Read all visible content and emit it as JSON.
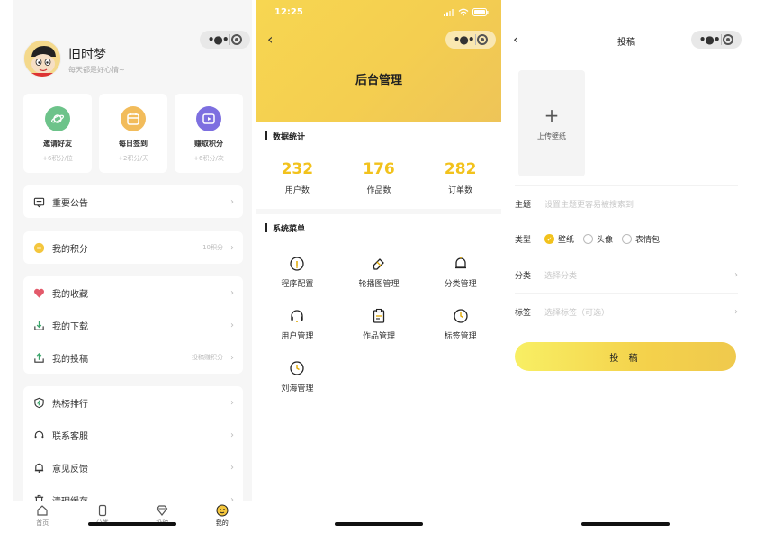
{
  "profile": {
    "name": "旧时梦",
    "sign": "每天都是好心情~",
    "cards": [
      {
        "title": "邀请好友",
        "sub": "+6积分/位",
        "color": "#6dc38a",
        "icon": "planet-icon"
      },
      {
        "title": "每日签到",
        "sub": "+2积分/天",
        "color": "#f2bc5b",
        "icon": "calendar-icon"
      },
      {
        "title": "赚取积分",
        "sub": "+6积分/次",
        "color": "#7d6fe0",
        "icon": "video-icon"
      }
    ],
    "notice": "重要公告",
    "points_label": "我的积分",
    "points_value": "10积分",
    "favorites": "我的收藏",
    "downloads": "我的下载",
    "posts": "我的投稿",
    "posts_extra": "投稿赚积分",
    "hot": "热榜排行",
    "service": "联系客服",
    "feedback": "意见反馈",
    "clear": "清理缓存",
    "tabs": [
      "首页",
      "分类",
      "投稿",
      "我的"
    ]
  },
  "admin": {
    "time": "12:25",
    "title": "后台管理",
    "stats_head": "数据统计",
    "stats": [
      {
        "num": "232",
        "label": "用户数"
      },
      {
        "num": "176",
        "label": "作品数"
      },
      {
        "num": "282",
        "label": "订单数"
      }
    ],
    "menu_head": "系统菜单",
    "menu": [
      "程序配置",
      "轮播图管理",
      "分类管理",
      "用户管理",
      "作品管理",
      "标签管理",
      "刘海管理"
    ]
  },
  "submit_page": {
    "title": "投稿",
    "upload_label": "上传壁纸",
    "theme_label": "主题",
    "theme_placeholder": "设置主题更容易被搜索到",
    "type_label": "类型",
    "types": [
      "壁纸",
      "头像",
      "表情包"
    ],
    "selected_type": "壁纸",
    "category_label": "分类",
    "category_placeholder": "选择分类",
    "tag_label": "标签",
    "tag_placeholder": "选择标签（可选）",
    "submit_label": "投 稿",
    "accent": "#f2c21c"
  }
}
